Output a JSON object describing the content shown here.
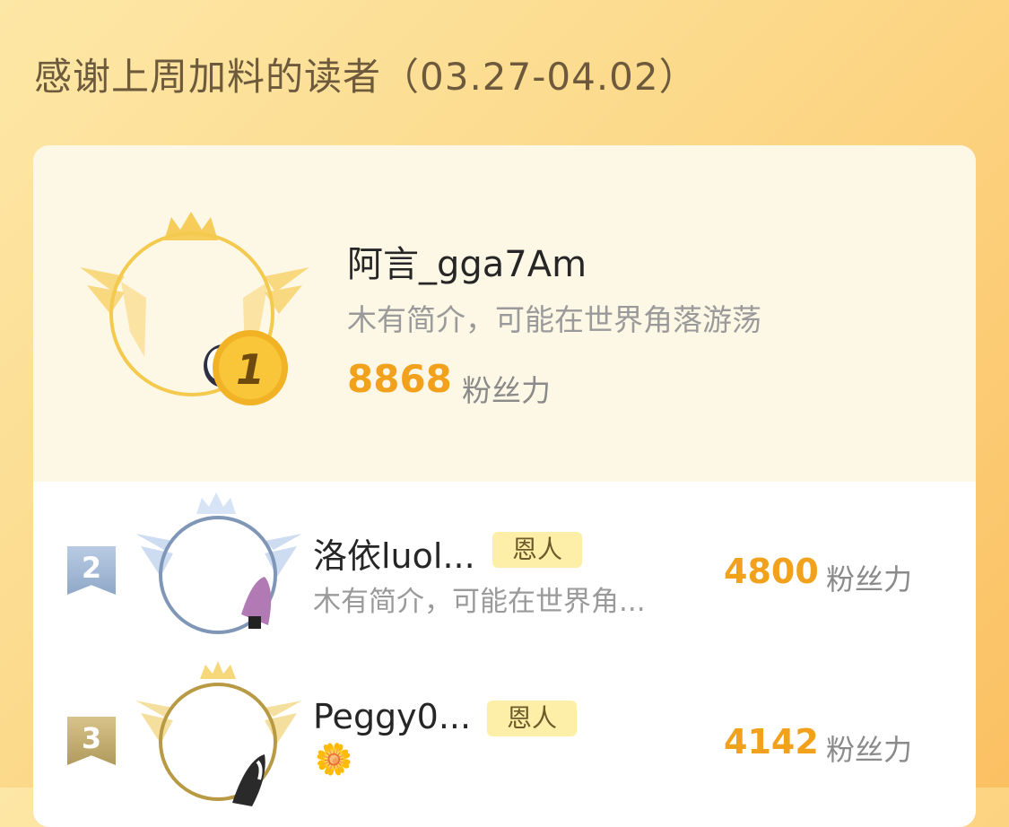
{
  "section_title": "感谢上周加料的读者（03.27-04.02）",
  "leaderboard": [
    {
      "rank": "1",
      "name": "阿言_gga7Am",
      "bio": "木有简介，可能在世界角落游荡",
      "fans": "8868",
      "fans_label": "粉丝力"
    },
    {
      "rank": "2",
      "name": "洛依luol...",
      "tag": "恩人",
      "bio": "木有简介，可能在世界角...",
      "fans": "4800",
      "fans_label": "粉丝力"
    },
    {
      "rank": "3",
      "name": "Peggy0...",
      "tag": "恩人",
      "bio_icon": "flower-emoji",
      "bio_glyph": "🌼",
      "fans": "4142",
      "fans_label": "粉丝力"
    }
  ],
  "colors": {
    "accent": "#f2a11c",
    "gold_frame": "#f3c94e",
    "silver_frame": "#7f96b7",
    "bronze_frame": "#b89a45",
    "tag_bg": "#fdefa7"
  }
}
